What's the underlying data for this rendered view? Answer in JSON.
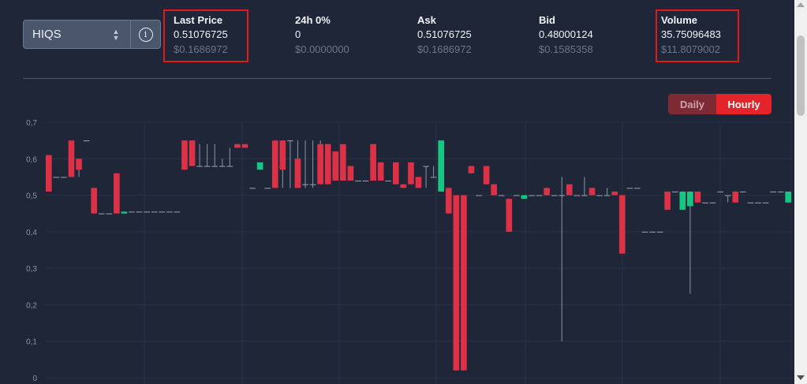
{
  "pair": {
    "label": "HIQS",
    "caret_icon": "up-down-caret-icon",
    "info_icon": "info-icon"
  },
  "stats": [
    {
      "label": "Last Price",
      "value": "0.51076725",
      "usd": "$0.1686972",
      "highlighted": true
    },
    {
      "label": "24h 0%",
      "value": "0",
      "usd": "$0.0000000",
      "highlighted": false
    },
    {
      "label": "Ask",
      "value": "0.51076725",
      "usd": "$0.1686972",
      "highlighted": false
    },
    {
      "label": "Bid",
      "value": "0.48000124",
      "usd": "$0.1585358",
      "highlighted": false
    },
    {
      "label": "Volume",
      "value": "35.75096483",
      "usd": "$11.8079002",
      "highlighted": true
    }
  ],
  "toggle": {
    "daily": "Daily",
    "hourly": "Hourly",
    "active": "hourly"
  },
  "colors": {
    "up": "#16c784",
    "down": "#dc3147",
    "highlight": "#e01919",
    "background": "#1f2638"
  },
  "chart_data": {
    "type": "candlestick",
    "ylim": [
      0,
      0.7
    ],
    "y_ticks": [
      "0",
      "0,1",
      "0,2",
      "0,3",
      "0,4",
      "0,5",
      "0,6",
      "0,7"
    ],
    "grid": true,
    "candles": [
      [
        0.61,
        0.65,
        0.65,
        0.51
      ],
      [
        0.55,
        0.55,
        0.55,
        0.55
      ],
      [
        0.55,
        0.55,
        0.55,
        0.55
      ],
      [
        0.65,
        0.65,
        0.55,
        0.55
      ],
      [
        0.6,
        0.6,
        0.55,
        0.57
      ],
      [
        0.65,
        0.65,
        0.65,
        0.65
      ],
      [
        0.52,
        0.52,
        0.45,
        0.45
      ],
      [
        0.45,
        0.45,
        0.45,
        0.45
      ],
      [
        0.45,
        0.45,
        0.45,
        0.45
      ],
      [
        0.56,
        0.56,
        0.45,
        0.45
      ],
      [
        0.45,
        0.455,
        0.45,
        0.455
      ],
      [
        0.455,
        0.455,
        0.455,
        0.455
      ],
      [
        0.455,
        0.455,
        0.455,
        0.455
      ],
      [
        0.455,
        0.455,
        0.455,
        0.455
      ],
      [
        0.455,
        0.455,
        0.455,
        0.455
      ],
      [
        0.455,
        0.455,
        0.455,
        0.455
      ],
      [
        0.455,
        0.455,
        0.455,
        0.455
      ],
      [
        0.455,
        0.455,
        0.455,
        0.455
      ],
      [
        0.65,
        0.65,
        0.57,
        0.57
      ],
      [
        0.65,
        0.65,
        0.58,
        0.58
      ],
      [
        0.58,
        0.64,
        0.58,
        0.58
      ],
      [
        0.58,
        0.64,
        0.58,
        0.58
      ],
      [
        0.58,
        0.64,
        0.58,
        0.58
      ],
      [
        0.58,
        0.6,
        0.58,
        0.58
      ],
      [
        0.58,
        0.63,
        0.58,
        0.58
      ],
      [
        0.64,
        0.64,
        0.63,
        0.63
      ],
      [
        0.64,
        0.64,
        0.63,
        0.63
      ],
      [
        0.52,
        0.52,
        0.52,
        0.52
      ],
      [
        0.57,
        0.59,
        0.57,
        0.59
      ],
      [
        0.52,
        0.52,
        0.52,
        0.52
      ],
      [
        0.65,
        0.65,
        0.52,
        0.52
      ],
      [
        0.65,
        0.65,
        0.52,
        0.57
      ],
      [
        0.65,
        0.65,
        0.52,
        0.65
      ],
      [
        0.6,
        0.65,
        0.52,
        0.52
      ],
      [
        0.53,
        0.65,
        0.52,
        0.53
      ],
      [
        0.53,
        0.65,
        0.52,
        0.53
      ],
      [
        0.64,
        0.65,
        0.53,
        0.53
      ],
      [
        0.64,
        0.64,
        0.53,
        0.53
      ],
      [
        0.62,
        0.62,
        0.54,
        0.54
      ],
      [
        0.64,
        0.64,
        0.54,
        0.54
      ],
      [
        0.58,
        0.58,
        0.54,
        0.54
      ],
      [
        0.54,
        0.54,
        0.54,
        0.54
      ],
      [
        0.54,
        0.54,
        0.54,
        0.54
      ],
      [
        0.64,
        0.64,
        0.54,
        0.54
      ],
      [
        0.59,
        0.59,
        0.54,
        0.54
      ],
      [
        0.54,
        0.54,
        0.54,
        0.54
      ],
      [
        0.59,
        0.59,
        0.53,
        0.53
      ],
      [
        0.53,
        0.53,
        0.52,
        0.52
      ],
      [
        0.59,
        0.59,
        0.53,
        0.53
      ],
      [
        0.55,
        0.55,
        0.52,
        0.52
      ],
      [
        0.58,
        0.58,
        0.52,
        0.58
      ],
      [
        0.55,
        0.58,
        0.55,
        0.55
      ],
      [
        0.51,
        0.65,
        0.51,
        0.65
      ],
      [
        0.52,
        0.52,
        0.45,
        0.45
      ],
      [
        0.5,
        0.5,
        0.02,
        0.02
      ],
      [
        0.5,
        0.5,
        0.02,
        0.02
      ],
      [
        0.58,
        0.58,
        0.56,
        0.56
      ],
      [
        0.5,
        0.5,
        0.5,
        0.5
      ],
      [
        0.58,
        0.58,
        0.53,
        0.53
      ],
      [
        0.53,
        0.53,
        0.5,
        0.5
      ],
      [
        0.5,
        0.5,
        0.5,
        0.5
      ],
      [
        0.49,
        0.49,
        0.4,
        0.4
      ],
      [
        0.5,
        0.5,
        0.5,
        0.5
      ],
      [
        0.49,
        0.5,
        0.49,
        0.5
      ],
      [
        0.5,
        0.5,
        0.5,
        0.5
      ],
      [
        0.5,
        0.5,
        0.5,
        0.5
      ],
      [
        0.52,
        0.52,
        0.5,
        0.5
      ],
      [
        0.5,
        0.5,
        0.5,
        0.5
      ],
      [
        0.5,
        0.55,
        0.1,
        0.5
      ],
      [
        0.53,
        0.53,
        0.5,
        0.5
      ],
      [
        0.5,
        0.5,
        0.5,
        0.5
      ],
      [
        0.5,
        0.55,
        0.5,
        0.5
      ],
      [
        0.52,
        0.52,
        0.5,
        0.5
      ],
      [
        0.5,
        0.5,
        0.5,
        0.5
      ],
      [
        0.5,
        0.52,
        0.5,
        0.5
      ],
      [
        0.51,
        0.51,
        0.5,
        0.5
      ],
      [
        0.5,
        0.5,
        0.34,
        0.34
      ],
      [
        0.52,
        0.52,
        0.52,
        0.52
      ],
      [
        0.52,
        0.52,
        0.52,
        0.52
      ],
      [
        0.4,
        0.4,
        0.4,
        0.4
      ],
      [
        0.4,
        0.4,
        0.4,
        0.4
      ],
      [
        0.4,
        0.4,
        0.4,
        0.4
      ],
      [
        0.51,
        0.51,
        0.46,
        0.46
      ],
      [
        0.51,
        0.51,
        0.51,
        0.51
      ],
      [
        0.46,
        0.51,
        0.46,
        0.51
      ],
      [
        0.47,
        0.51,
        0.23,
        0.51
      ],
      [
        0.51,
        0.51,
        0.48,
        0.48
      ],
      [
        0.48,
        0.48,
        0.48,
        0.48
      ],
      [
        0.48,
        0.48,
        0.48,
        0.48
      ],
      [
        0.51,
        0.51,
        0.51,
        0.51
      ],
      [
        0.5,
        0.5,
        0.48,
        0.5
      ],
      [
        0.51,
        0.51,
        0.48,
        0.48
      ],
      [
        0.51,
        0.51,
        0.51,
        0.51
      ],
      [
        0.48,
        0.48,
        0.48,
        0.48
      ],
      [
        0.48,
        0.48,
        0.48,
        0.48
      ],
      [
        0.48,
        0.48,
        0.48,
        0.48
      ],
      [
        0.51,
        0.51,
        0.51,
        0.51
      ],
      [
        0.51,
        0.51,
        0.51,
        0.51
      ],
      [
        0.48,
        0.51,
        0.48,
        0.51
      ]
    ]
  }
}
